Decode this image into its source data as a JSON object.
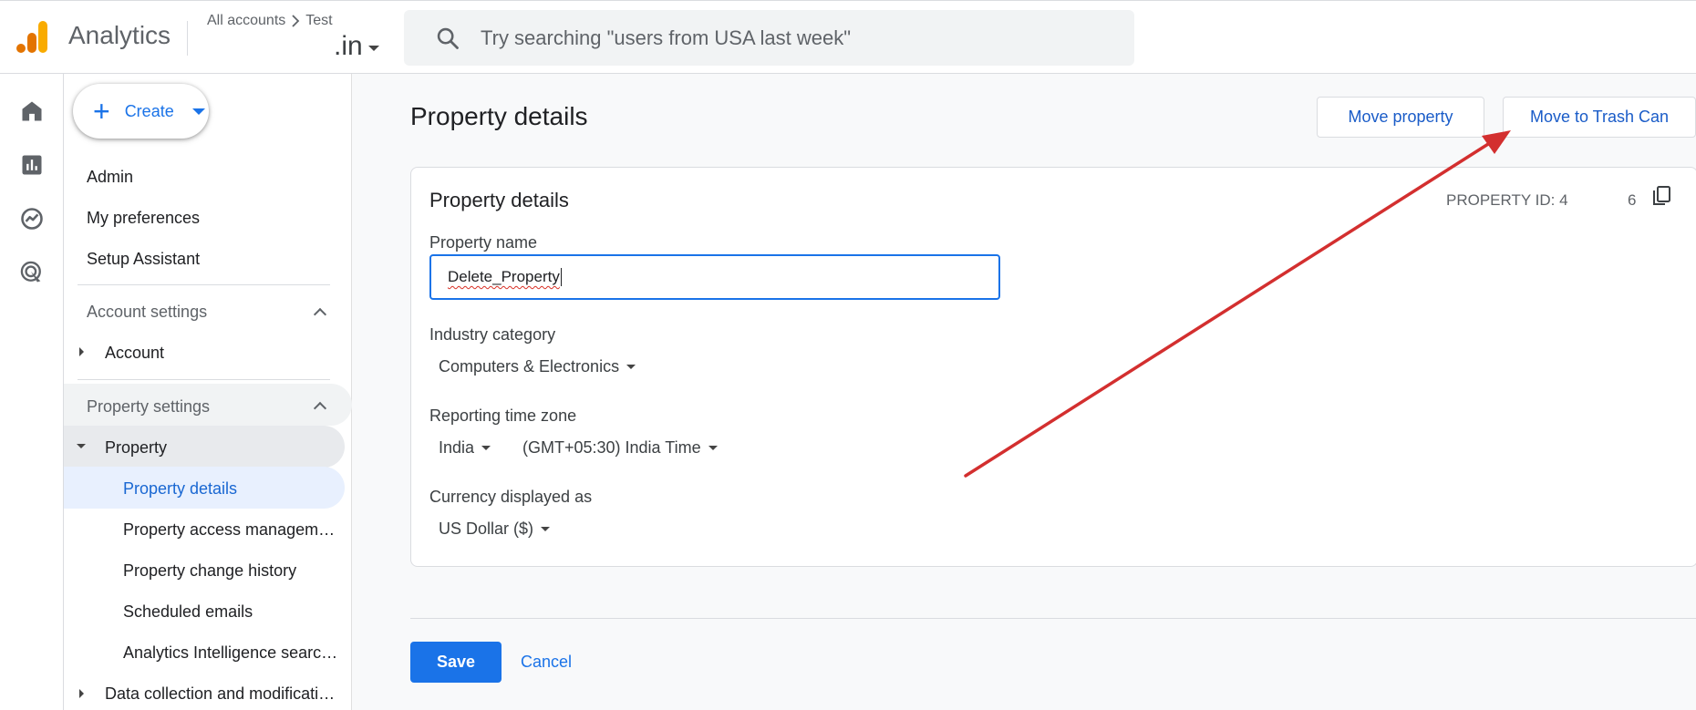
{
  "app": {
    "title": "Analytics",
    "breadcrumb": [
      "All accounts",
      "Test"
    ],
    "account_name": ".in"
  },
  "search": {
    "placeholder": "Try searching \"users from USA last week\""
  },
  "rail": {
    "icons": [
      "home-icon",
      "reports-icon",
      "explore-icon",
      "advertising-icon"
    ]
  },
  "sidenav": {
    "create_label": "Create",
    "items": [
      "Admin",
      "My preferences",
      "Setup Assistant"
    ],
    "account_settings": {
      "label": "Account settings",
      "items": [
        "Account"
      ]
    },
    "property_settings": {
      "label": "Property settings",
      "property_label": "Property",
      "sub_items": [
        "Property details",
        "Property access management",
        "Property change history",
        "Scheduled emails",
        "Analytics Intelligence search history"
      ],
      "selected": "Property details",
      "data_collection_label": "Data collection and modifications"
    }
  },
  "main": {
    "page_title": "Property details",
    "move_property_label": "Move property",
    "move_to_trash_label": "Move to Trash Can",
    "card": {
      "title": "Property details",
      "property_id_label": "PROPERTY ID: 4",
      "property_id_tail": "6",
      "property_name_label": "Property name",
      "property_name_value": "Delete_Property",
      "industry_category_label": "Industry category",
      "industry_category_value": "Computers & Electronics",
      "reporting_tz_label": "Reporting time zone",
      "tz_country": "India",
      "tz_value": "(GMT+05:30) India Time",
      "currency_label": "Currency displayed as",
      "currency_value": "US Dollar ($)"
    },
    "save_label": "Save",
    "cancel_label": "Cancel"
  },
  "colors": {
    "accent": "#1a73e8",
    "annotation_arrow": "#d32f2f",
    "logo_orange": "#f9ab00",
    "logo_dark_orange": "#e37400"
  }
}
